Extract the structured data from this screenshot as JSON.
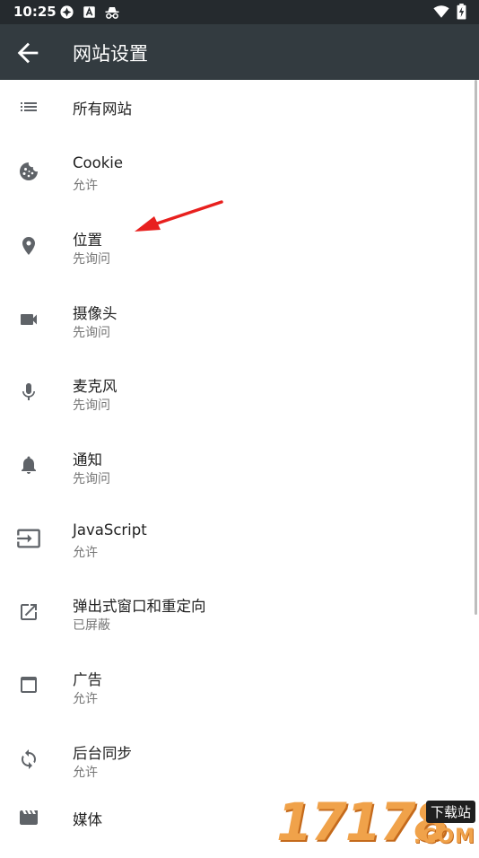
{
  "status_bar": {
    "time": "10:25"
  },
  "app_bar": {
    "title": "网站设置",
    "back_icon": "arrow-back-icon"
  },
  "items": [
    {
      "title": "所有网站",
      "subtitle": "",
      "icon": "list-icon"
    },
    {
      "title": "Cookie",
      "subtitle": "允许",
      "icon": "cookie-icon"
    },
    {
      "title": "位置",
      "subtitle": "先询问",
      "icon": "location-pin-icon"
    },
    {
      "title": "摄像头",
      "subtitle": "先询问",
      "icon": "videocam-icon"
    },
    {
      "title": "麦克风",
      "subtitle": "先询问",
      "icon": "mic-icon"
    },
    {
      "title": "通知",
      "subtitle": "先询问",
      "icon": "bell-icon"
    },
    {
      "title": "JavaScript",
      "subtitle": "允许",
      "icon": "input-icon"
    },
    {
      "title": "弹出式窗口和重定向",
      "subtitle": "已屏蔽",
      "icon": "open-in-new-icon"
    },
    {
      "title": "广告",
      "subtitle": "允许",
      "icon": "window-icon"
    },
    {
      "title": "后台同步",
      "subtitle": "允许",
      "icon": "sync-icon"
    },
    {
      "title": "媒体",
      "subtitle": "",
      "icon": "movie-icon"
    }
  ],
  "watermark": {
    "digits": "17178",
    "badge": "下载站",
    "domain": ".COM"
  },
  "colors": {
    "status_bar": "#252a2e",
    "app_bar": "#333b40",
    "icon": "#5f6368",
    "annotation_arrow": "#e8201e"
  }
}
